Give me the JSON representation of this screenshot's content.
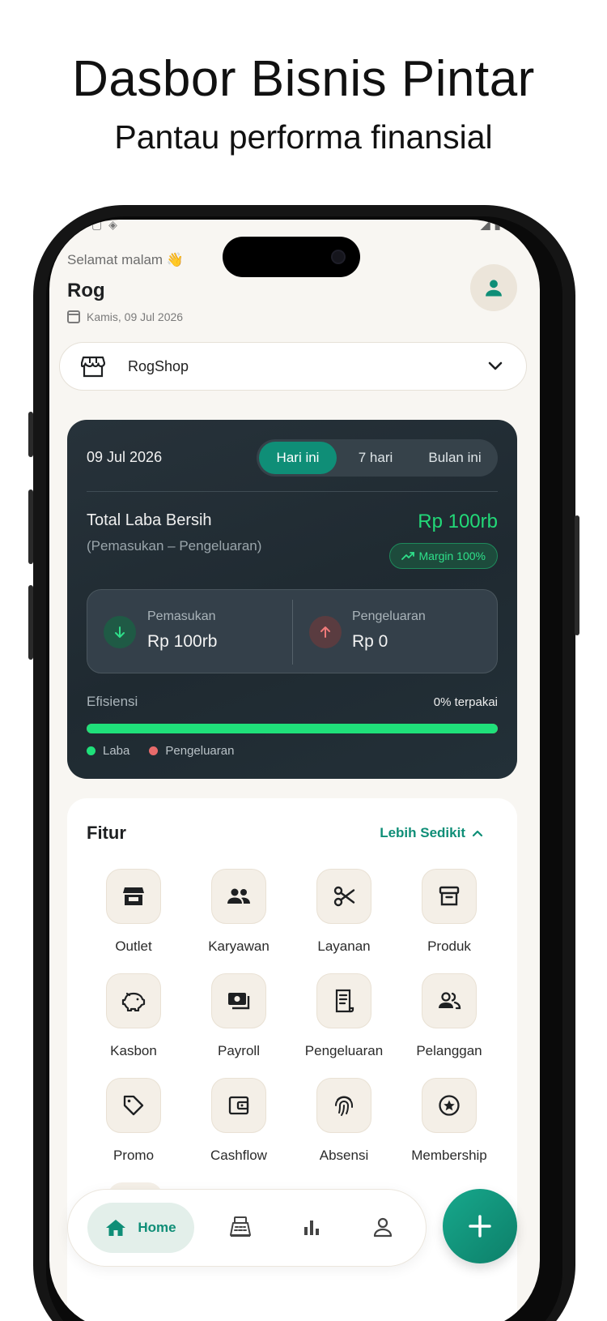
{
  "promo": {
    "headline": "Dasbor Bisnis Pintar",
    "subheadline": "Pantau performa finansial"
  },
  "header": {
    "greeting": "Selamat malam 👋",
    "user_name": "Rog",
    "date": "Kamis, 09 Jul 2026"
  },
  "shop_selector": {
    "selected": "RogShop"
  },
  "summary": {
    "date": "09 Jul 2026",
    "periods": [
      "Hari ini",
      "7 hari",
      "Bulan ini"
    ],
    "active_period": "Hari ini",
    "net_profit_label": "Total Laba Bersih",
    "net_profit_formula": "(Pemasukan – Pengeluaran)",
    "net_profit_value": "Rp 100rb",
    "margin": "Margin 100%",
    "income_label": "Pemasukan",
    "income_value": "Rp 100rb",
    "expense_label": "Pengeluaran",
    "expense_value": "Rp 0",
    "efficiency_label": "Efisiensi",
    "efficiency_used": "0% terpakai",
    "efficiency_profit_fraction": 1.0,
    "legend_profit": "Laba",
    "legend_expense": "Pengeluaran",
    "colors": {
      "profit": "#1fe07a",
      "expense": "#e86b6b",
      "accent": "#0f8e77"
    }
  },
  "features": {
    "title": "Fitur",
    "toggle_label": "Lebih Sedikit",
    "items": [
      {
        "label": "Outlet",
        "icon": "store-icon"
      },
      {
        "label": "Karyawan",
        "icon": "people-icon"
      },
      {
        "label": "Layanan",
        "icon": "scissors-icon"
      },
      {
        "label": "Produk",
        "icon": "archive-box-icon"
      },
      {
        "label": "Kasbon",
        "icon": "piggy-bank-icon"
      },
      {
        "label": "Payroll",
        "icon": "money-icon"
      },
      {
        "label": "Pengeluaran",
        "icon": "receipt-icon"
      },
      {
        "label": "Pelanggan",
        "icon": "customers-icon"
      },
      {
        "label": "Promo",
        "icon": "tag-icon"
      },
      {
        "label": "Cashflow",
        "icon": "wallet-icon"
      },
      {
        "label": "Absensi",
        "icon": "fingerprint-icon"
      },
      {
        "label": "Membership",
        "icon": "star-badge-icon"
      }
    ]
  },
  "bottom_nav": {
    "home_label": "Home",
    "items": [
      "home-icon",
      "cash-register-icon",
      "bar-chart-icon",
      "profile-icon"
    ]
  }
}
